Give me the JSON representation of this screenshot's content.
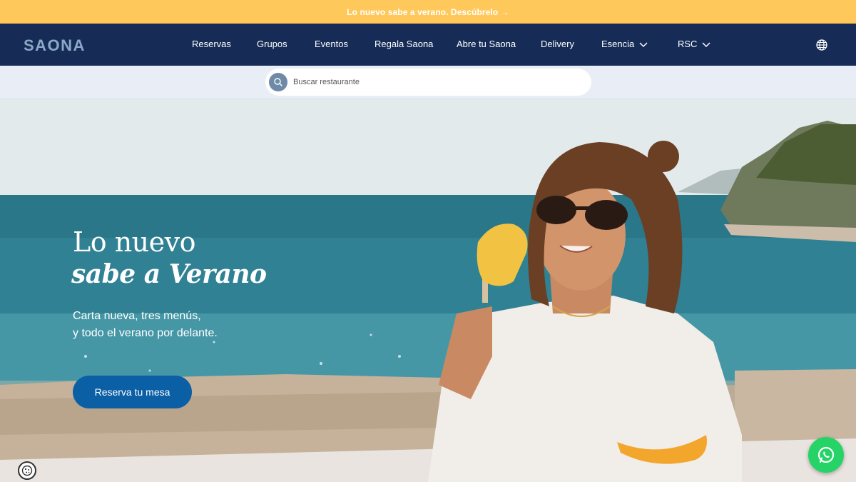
{
  "announcement": {
    "text": "Lo nuevo sabe a verano. Descúbrelo →",
    "bg_color": "#ffc85a"
  },
  "nav": {
    "logo": "SAONA",
    "items": [
      {
        "label": "Reservas",
        "has_dropdown": false
      },
      {
        "label": "Grupos",
        "has_dropdown": false
      },
      {
        "label": "Eventos",
        "has_dropdown": false
      },
      {
        "label": "Regala Saona",
        "has_dropdown": false
      },
      {
        "label": "Abre tu Saona",
        "has_dropdown": false
      },
      {
        "label": "Delivery",
        "has_dropdown": false
      },
      {
        "label": "Esencia",
        "has_dropdown": true
      },
      {
        "label": "RSC",
        "has_dropdown": true
      }
    ],
    "language_icon": "globe-icon",
    "bg_color": "#162c56"
  },
  "search": {
    "placeholder": "Buscar restaurante",
    "value": "",
    "icon": "search-icon"
  },
  "hero": {
    "title_line1": "Lo nuevo",
    "title_line2": "sabe a Verano",
    "subtitle_line1": "Carta nueva, tres menús,",
    "subtitle_line2": "y todo el verano por delante.",
    "cta_label": "Reserva tu mesa",
    "cta_color": "#0b5fa5"
  },
  "floating": {
    "cookie_icon": "cookie-icon",
    "whatsapp_icon": "whatsapp-icon",
    "whatsapp_color": "#25d366"
  }
}
